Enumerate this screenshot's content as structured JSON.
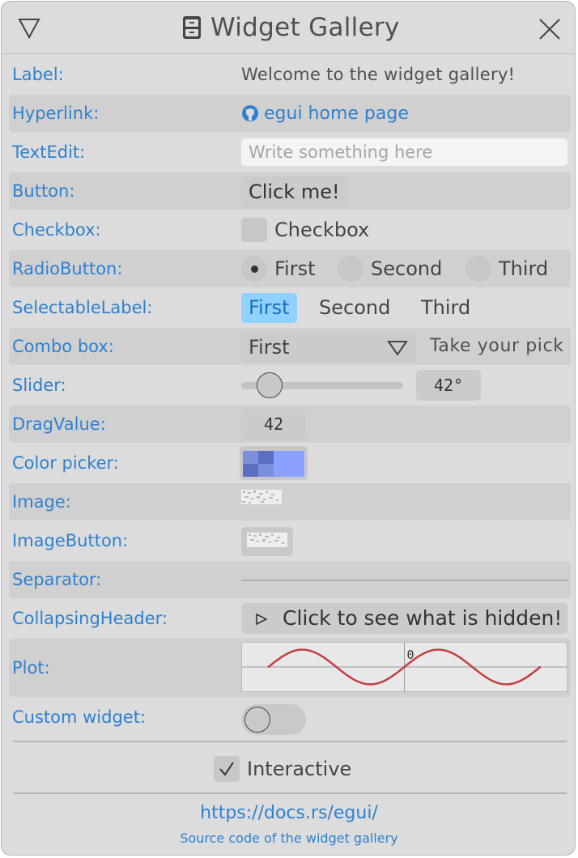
{
  "window": {
    "title": "Widget Gallery",
    "icons": {
      "collapse": "triangle-down-icon",
      "title": "file-cabinet-icon",
      "close": "close-icon"
    }
  },
  "rows": {
    "label": {
      "label": "Label:",
      "text": "Welcome to the widget gallery!"
    },
    "hyperlink": {
      "label": "Hyperlink:",
      "icon": "github-icon",
      "text": "egui home page"
    },
    "textedit": {
      "label": "TextEdit:",
      "value": "",
      "placeholder": "Write something here"
    },
    "button": {
      "label": "Button:",
      "text": "Click me!"
    },
    "checkbox": {
      "label": "Checkbox:",
      "text": "Checkbox",
      "checked": false
    },
    "radio": {
      "label": "RadioButton:",
      "options": [
        "First",
        "Second",
        "Third"
      ],
      "selected": "First"
    },
    "selectable": {
      "label": "SelectableLabel:",
      "options": [
        "First",
        "Second",
        "Third"
      ],
      "selected": "First"
    },
    "combo": {
      "label": "Combo box:",
      "value": "First",
      "hint": "Take your pick"
    },
    "slider": {
      "label": "Slider:",
      "value": 42,
      "value_text": "42°"
    },
    "dragvalue": {
      "label": "DragValue:",
      "value": "42"
    },
    "colorpicker": {
      "label": "Color picker:",
      "color": "#8ca0ff"
    },
    "image": {
      "label": "Image:"
    },
    "imagebutton": {
      "label": "ImageButton:"
    },
    "separator": {
      "label": "Separator:"
    },
    "collapsing": {
      "label": "CollapsingHeader:",
      "text": "Click to see what is hidden!"
    },
    "plot": {
      "label": "Plot:",
      "axis_label": "0"
    },
    "custom": {
      "label": "Custom widget:",
      "on": false
    }
  },
  "footer": {
    "interactive_label": "Interactive",
    "interactive_checked": true,
    "docs_link": "https://docs.rs/egui/",
    "source_link": "Source code of the widget gallery"
  },
  "chart_data": {
    "type": "line",
    "series": [
      {
        "values": "sin(x)",
        "color": "#c04040"
      }
    ],
    "x": [
      -6.3,
      -5.3,
      -4.3,
      -3.3,
      -2.3,
      -1.3,
      -0.3,
      0,
      0.7,
      1.7,
      2.7,
      3.7,
      4.7,
      5.7,
      6.3
    ],
    "y": [
      0.02,
      0.83,
      0.92,
      0.16,
      -0.75,
      -0.96,
      -0.3,
      0,
      0.64,
      0.99,
      0.43,
      -0.53,
      -1.0,
      -0.55,
      0.02
    ],
    "xlim": [
      -7.5,
      7.5
    ],
    "ylim": [
      -1.4,
      1.4
    ],
    "tick_labels": [
      "0"
    ],
    "colors": {
      "line": "#c04040",
      "background": "#e8e8e8"
    }
  },
  "colors": {
    "accent": "#2f80d0",
    "selected_bg": "#90d1ff",
    "panel": "#dcdcdc"
  }
}
